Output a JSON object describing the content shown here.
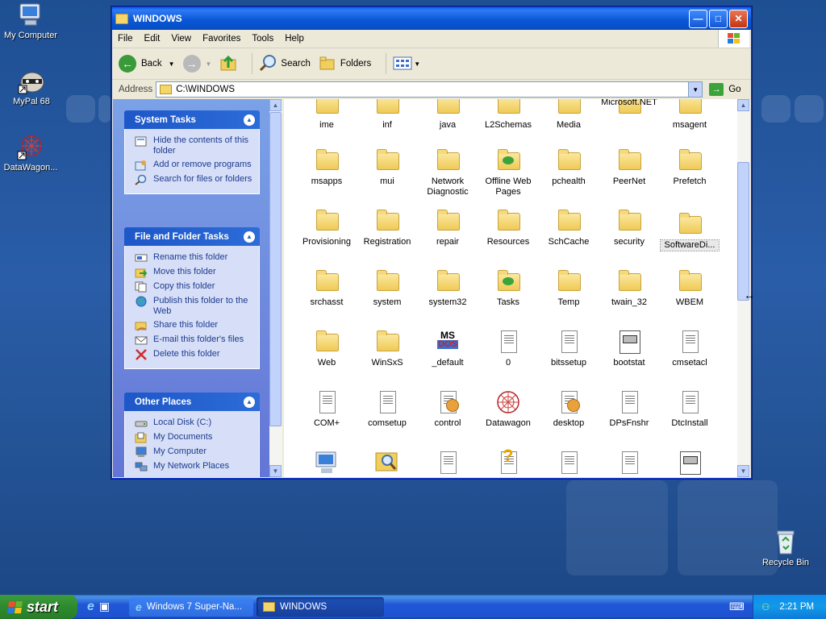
{
  "desktop": {
    "icons": [
      {
        "label": "My Computer",
        "icon": "my-computer-icon"
      },
      {
        "label": "MyPal 68",
        "icon": "mypal-icon"
      },
      {
        "label": "DataWagon...",
        "icon": "datawagon-icon"
      },
      {
        "label": "Recycle Bin",
        "icon": "recycle-bin-icon"
      }
    ]
  },
  "window": {
    "title": "WINDOWS",
    "menu": [
      "File",
      "Edit",
      "View",
      "Favorites",
      "Tools",
      "Help"
    ],
    "toolbar": {
      "back": "Back",
      "search": "Search",
      "folders": "Folders"
    },
    "address": {
      "label": "Address",
      "value": "C:\\WINDOWS",
      "go": "Go"
    }
  },
  "left_pane": {
    "system_tasks": {
      "title": "System Tasks",
      "items": [
        "Hide the contents of this folder",
        "Add or remove programs",
        "Search for files or folders"
      ]
    },
    "file_folder_tasks": {
      "title": "File and Folder Tasks",
      "items": [
        "Rename this folder",
        "Move this folder",
        "Copy this folder",
        "Publish this folder to the Web",
        "Share this folder",
        "E-mail this folder's files",
        "Delete this folder"
      ]
    },
    "other_places": {
      "title": "Other Places",
      "items": [
        "Local Disk (C:)",
        "My Documents",
        "My Computer",
        "My Network Places"
      ]
    }
  },
  "files": [
    {
      "name": "ime",
      "type": "folder"
    },
    {
      "name": "inf",
      "type": "folder"
    },
    {
      "name": "java",
      "type": "folder"
    },
    {
      "name": "L2Schemas",
      "type": "folder"
    },
    {
      "name": "Media",
      "type": "folder"
    },
    {
      "name": "Microsoft.NET",
      "type": "folder"
    },
    {
      "name": "msagent",
      "type": "folder"
    },
    {
      "name": "msapps",
      "type": "folder"
    },
    {
      "name": "mui",
      "type": "folder"
    },
    {
      "name": "Network Diagnostic",
      "type": "folder"
    },
    {
      "name": "Offline Web Pages",
      "type": "special-folder"
    },
    {
      "name": "pchealth",
      "type": "folder"
    },
    {
      "name": "PeerNet",
      "type": "folder"
    },
    {
      "name": "Prefetch",
      "type": "folder"
    },
    {
      "name": "Provisioning",
      "type": "folder"
    },
    {
      "name": "Registration",
      "type": "folder"
    },
    {
      "name": "repair",
      "type": "folder"
    },
    {
      "name": "Resources",
      "type": "folder"
    },
    {
      "name": "SchCache",
      "type": "folder"
    },
    {
      "name": "security",
      "type": "folder"
    },
    {
      "name": "SoftwareDi...",
      "type": "folder"
    },
    {
      "name": "srchasst",
      "type": "folder"
    },
    {
      "name": "system",
      "type": "folder"
    },
    {
      "name": "system32",
      "type": "folder"
    },
    {
      "name": "Tasks",
      "type": "special-folder"
    },
    {
      "name": "Temp",
      "type": "folder"
    },
    {
      "name": "twain_32",
      "type": "folder"
    },
    {
      "name": "WBEM",
      "type": "folder"
    },
    {
      "name": "Web",
      "type": "folder"
    },
    {
      "name": "WinSxS",
      "type": "folder"
    },
    {
      "name": "_default",
      "type": "app"
    },
    {
      "name": "0",
      "type": "doc"
    },
    {
      "name": "bitssetup",
      "type": "doc"
    },
    {
      "name": "bootstat",
      "type": "dat"
    },
    {
      "name": "cmsetacl",
      "type": "doc"
    },
    {
      "name": "COM+",
      "type": "doc"
    },
    {
      "name": "comsetup",
      "type": "doc"
    },
    {
      "name": "control",
      "type": "doc-gear"
    },
    {
      "name": "Datawagon",
      "type": "datawagon"
    },
    {
      "name": "desktop",
      "type": "doc-gear"
    },
    {
      "name": "DPsFnshr",
      "type": "doc"
    },
    {
      "name": "DtcInstall",
      "type": "doc"
    },
    {
      "name": "",
      "type": "computer"
    },
    {
      "name": "",
      "type": "search"
    },
    {
      "name": "",
      "type": "doc"
    },
    {
      "name": "",
      "type": "help"
    },
    {
      "name": "",
      "type": "doc"
    },
    {
      "name": "",
      "type": "doc"
    },
    {
      "name": "",
      "type": "dat"
    }
  ],
  "taskbar": {
    "start": "start",
    "tasks": [
      {
        "label": "Windows 7 Super-Na...",
        "active": false
      },
      {
        "label": "WINDOWS",
        "active": true
      }
    ],
    "clock": "2:21 PM"
  }
}
